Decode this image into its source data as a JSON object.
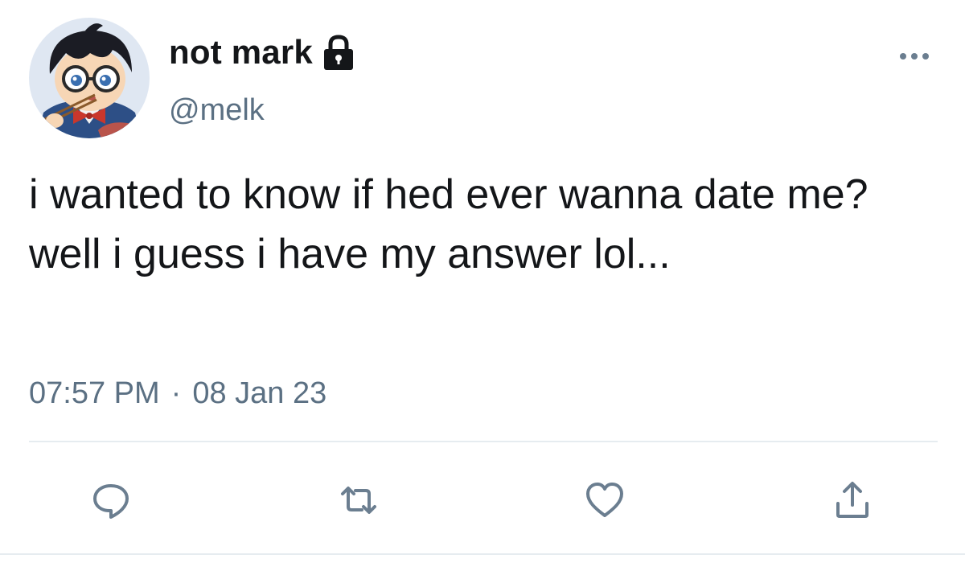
{
  "user": {
    "display_name": "not mark",
    "handle": "@melk",
    "protected_icon": "lock-icon",
    "avatar": "avatar-image"
  },
  "tweet": {
    "text": "i wanted to know if hed ever wanna date me? well i guess i have my answer lol...",
    "time": "07:57 PM",
    "separator": "·",
    "date": "08 Jan 23"
  },
  "actions": [
    {
      "name": "reply",
      "icon": "reply-icon"
    },
    {
      "name": "retweet",
      "icon": "retweet-icon"
    },
    {
      "name": "like",
      "icon": "heart-icon"
    },
    {
      "name": "share",
      "icon": "share-icon"
    }
  ],
  "menu": {
    "icon": "more-options-icon"
  },
  "colors": {
    "text": "#141619",
    "secondary": "#5b7083",
    "divider": "#e6ecf0"
  }
}
